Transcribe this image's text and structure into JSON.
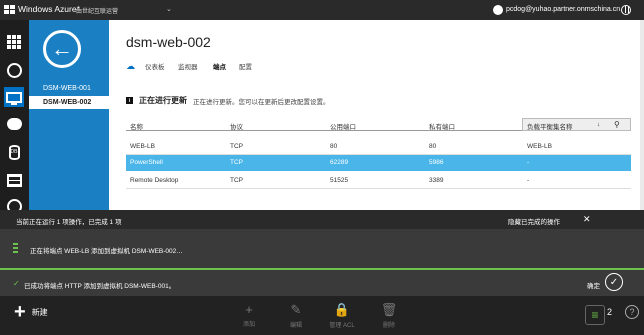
{
  "header": {
    "brand": "Windows Azure*",
    "subscription": "由世纪互联运营",
    "user": "pcdog@yuhao.partner.onmschina.cn"
  },
  "nav": {
    "items": [
      "DSM-WEB-001",
      "DSM-WEB-002"
    ]
  },
  "main": {
    "title": "dsm-web-002",
    "tabs": [
      "仪表板",
      "监视器",
      "端点",
      "配置"
    ],
    "active_tab": "端点",
    "notice_title": "正在进行更新",
    "notice_msg": "正在进行更新。您可以在更新后更改配置设置。"
  },
  "table": {
    "columns": [
      "名称",
      "协议",
      "公用端口",
      "私有端口",
      "负载平衡集名称"
    ],
    "rows": [
      [
        "WEB-LB",
        "TCP",
        "80",
        "80",
        "WEB-LB"
      ],
      [
        "PowerShell",
        "TCP",
        "62289",
        "5986",
        "-"
      ],
      [
        "Remote Desktop",
        "TCP",
        "51525",
        "3389",
        "-"
      ]
    ],
    "selected_row": 1
  },
  "ops": {
    "summary": "当前正在运行 1 项操作，已完成 1 项",
    "hide_label": "隐藏已完成的操作",
    "running": "正在将端点 WEB-LB 添加到虚拟机 DSM-WEB-002…",
    "done": "已成功将端点 HTTP 添加到虚拟机 DSM-WEB-001。",
    "ok": "确定"
  },
  "commands": {
    "new": "新建",
    "add": "添加",
    "edit": "编辑",
    "acl": "管理 ACL",
    "delete": "删除",
    "ops_count": "2"
  },
  "colors": {
    "accent": "#0072c6",
    "nav_blue": "#1b80c3",
    "selected_row": "#4ab5e8",
    "success": "#6cc24a"
  }
}
